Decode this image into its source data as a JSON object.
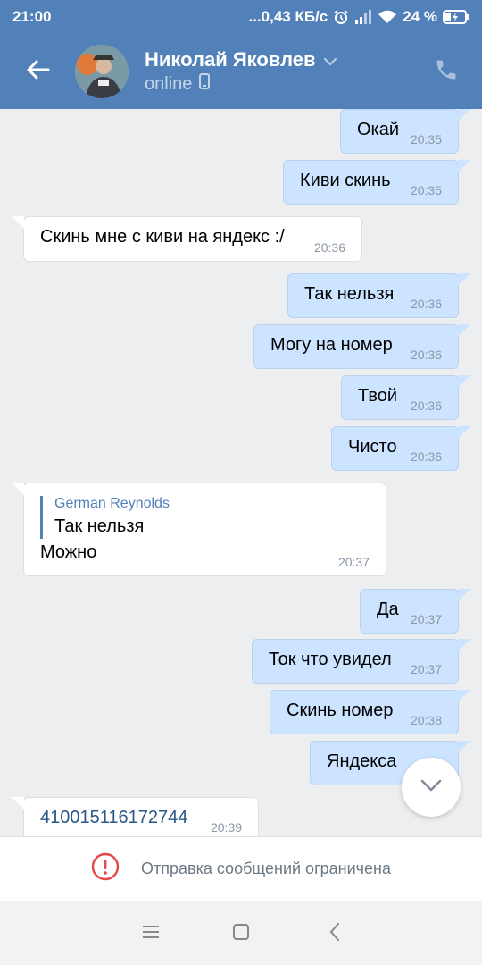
{
  "status_bar": {
    "time": "21:00",
    "net_speed": "...0,43 КБ/с",
    "battery": "24 %"
  },
  "header": {
    "contact_name": "Николай Яковлев",
    "contact_status": "online"
  },
  "messages": [
    {
      "dir": "out",
      "text": "Окай",
      "time": "20:35"
    },
    {
      "dir": "out",
      "text": "Киви скинь",
      "time": "20:35"
    },
    {
      "dir": "in",
      "text": "Скинь мне с киви на яндекс :/",
      "time": "20:36"
    },
    {
      "dir": "out",
      "text": "Так нельзя",
      "time": "20:36"
    },
    {
      "dir": "out",
      "text": "Могу на номер",
      "time": "20:36"
    },
    {
      "dir": "out",
      "text": "Твой",
      "time": "20:36"
    },
    {
      "dir": "out",
      "text": "Чисто",
      "time": "20:36"
    },
    {
      "dir": "in",
      "reply_author": "German Reynolds",
      "reply_text": "Так нельзя",
      "text": "Можно",
      "time": "20:37"
    },
    {
      "dir": "out",
      "text": "Да",
      "time": "20:37"
    },
    {
      "dir": "out",
      "text": "Ток что увидел",
      "time": "20:37"
    },
    {
      "dir": "out",
      "text": "Скинь номер",
      "time": "20:38"
    },
    {
      "dir": "out",
      "text": "Яндекса",
      "time": ""
    },
    {
      "dir": "in",
      "text": "410015116172744",
      "time": "20:39"
    }
  ],
  "composer": {
    "restricted_text": "Отправка сообщений ограничена"
  },
  "icons": {
    "back": "arrow-left-icon",
    "call": "phone-icon",
    "scroll_down": "chevron-down-icon",
    "warning": "exclamation-circle-icon",
    "nav_menu": "menu-icon",
    "nav_home": "square-icon",
    "nav_back": "chevron-left-icon"
  },
  "colors": {
    "header": "#5181b8",
    "outgoing_bubble": "#cce4ff",
    "incoming_bubble": "#ffffff",
    "warning": "#e64646"
  }
}
